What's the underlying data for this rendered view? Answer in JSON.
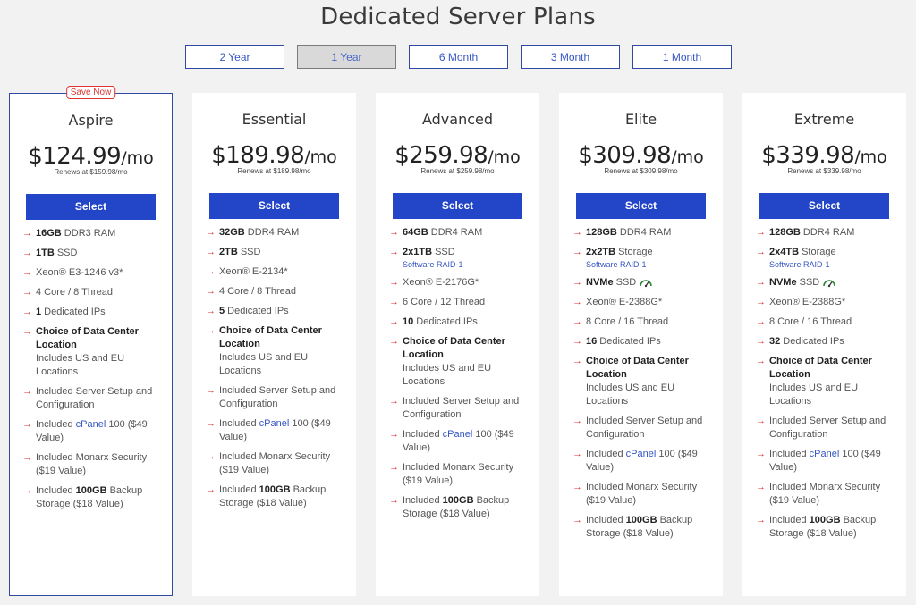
{
  "page": {
    "title": "Dedicated Server Plans"
  },
  "tabs": [
    {
      "label": "2 Year",
      "active": false
    },
    {
      "label": "1 Year",
      "active": true
    },
    {
      "label": "6 Month",
      "active": false
    },
    {
      "label": "3 Month",
      "active": false
    },
    {
      "label": "1 Month",
      "active": false
    }
  ],
  "colors": {
    "accent": "#2345c8",
    "arrow": "#dd3333",
    "badge": "#dd3333",
    "link": "#3656c4"
  },
  "icons": {
    "bullet": "right-arrow-icon",
    "nvme": "speedometer-icon"
  },
  "plans": [
    {
      "name": "Aspire",
      "badge": "Save Now",
      "price": "$124.99",
      "per": "/mo",
      "renews": "Renews at $159.98/mo",
      "button": "Select",
      "features": [
        {
          "bold": "16GB",
          "text": " DDR3 RAM"
        },
        {
          "bold": "1TB",
          "text": " SSD"
        },
        {
          "text": "Xeon® E3-1246 v3*"
        },
        {
          "text": "4 Core / 8 Thread"
        },
        {
          "bold": "1",
          "text": " Dedicated IPs"
        },
        {
          "bold": "Choice of Data Center Location",
          "text": "Includes US and EU Locations",
          "block": true
        },
        {
          "text": "Included Server Setup and Configuration"
        },
        {
          "pre": "Included ",
          "link": "cPanel",
          "text": " 100 ($49 Value)"
        },
        {
          "text": "Included Monarx Security ($19 Value)"
        },
        {
          "pre": "Included ",
          "bold": "100GB",
          "text": " Backup Storage ($18 Value)"
        }
      ]
    },
    {
      "name": "Essential",
      "price": "$189.98",
      "per": "/mo",
      "renews": "Renews at $189.98/mo",
      "button": "Select",
      "features": [
        {
          "bold": "32GB",
          "text": " DDR4 RAM"
        },
        {
          "bold": "2TB",
          "text": " SSD"
        },
        {
          "text": "Xeon® E-2134*"
        },
        {
          "text": "4 Core / 8 Thread"
        },
        {
          "bold": "5",
          "text": " Dedicated IPs"
        },
        {
          "bold": "Choice of Data Center Location",
          "text": "Includes US and EU Locations",
          "block": true
        },
        {
          "text": "Included Server Setup and Configuration"
        },
        {
          "pre": "Included ",
          "link": "cPanel",
          "text": " 100 ($49 Value)"
        },
        {
          "text": "Included Monarx Security ($19 Value)"
        },
        {
          "pre": "Included ",
          "bold": "100GB",
          "text": " Backup Storage ($18 Value)"
        }
      ]
    },
    {
      "name": "Advanced",
      "price": "$259.98",
      "per": "/mo",
      "renews": "Renews at $259.98/mo",
      "button": "Select",
      "features": [
        {
          "bold": "64GB",
          "text": " DDR4 RAM"
        },
        {
          "bold": "2x1TB",
          "text": " SSD",
          "sub": "Software RAID-1"
        },
        {
          "text": "Xeon® E-2176G*"
        },
        {
          "text": "6 Core / 12 Thread"
        },
        {
          "bold": "10",
          "text": " Dedicated IPs"
        },
        {
          "bold": "Choice of Data Center Location",
          "text": "Includes US and EU Locations",
          "block": true
        },
        {
          "text": "Included Server Setup and Configuration"
        },
        {
          "pre": "Included ",
          "link": "cPanel",
          "text": " 100 ($49 Value)"
        },
        {
          "text": "Included Monarx Security ($19 Value)"
        },
        {
          "pre": "Included ",
          "bold": "100GB",
          "text": " Backup Storage ($18 Value)"
        }
      ]
    },
    {
      "name": "Elite",
      "price": "$309.98",
      "per": "/mo",
      "renews": "Renews at $309.98/mo",
      "button": "Select",
      "features": [
        {
          "bold": "128GB",
          "text": " DDR4 RAM"
        },
        {
          "bold": "2x2TB",
          "text": " Storage",
          "sub": "Software RAID-1"
        },
        {
          "bold": "NVMe",
          "text": " SSD",
          "nvme": true
        },
        {
          "text": "Xeon® E-2388G*"
        },
        {
          "text": "8 Core / 16 Thread"
        },
        {
          "bold": "16",
          "text": " Dedicated IPs"
        },
        {
          "bold": "Choice of Data Center Location",
          "text": "Includes US and EU Locations",
          "block": true
        },
        {
          "text": "Included Server Setup and Configuration"
        },
        {
          "pre": "Included ",
          "link": "cPanel",
          "text": " 100 ($49 Value)"
        },
        {
          "text": "Included Monarx Security ($19 Value)"
        },
        {
          "pre": "Included ",
          "bold": "100GB",
          "text": " Backup Storage ($18 Value)"
        }
      ]
    },
    {
      "name": "Extreme",
      "price": "$339.98",
      "per": "/mo",
      "renews": "Renews at $339.98/mo",
      "button": "Select",
      "features": [
        {
          "bold": "128GB",
          "text": " DDR4 RAM"
        },
        {
          "bold": "2x4TB",
          "text": " Storage",
          "sub": "Software RAID-1"
        },
        {
          "bold": "NVMe",
          "text": " SSD",
          "nvme": true
        },
        {
          "text": "Xeon® E-2388G*"
        },
        {
          "text": "8 Core / 16 Thread"
        },
        {
          "bold": "32",
          "text": " Dedicated IPs"
        },
        {
          "bold": "Choice of Data Center Location",
          "text": "Includes US and EU Locations",
          "block": true
        },
        {
          "text": "Included Server Setup and Configuration"
        },
        {
          "pre": "Included ",
          "link": "cPanel",
          "text": " 100 ($49 Value)"
        },
        {
          "text": "Included Monarx Security ($19 Value)"
        },
        {
          "pre": "Included ",
          "bold": "100GB",
          "text": " Backup Storage ($18 Value)"
        }
      ]
    }
  ]
}
